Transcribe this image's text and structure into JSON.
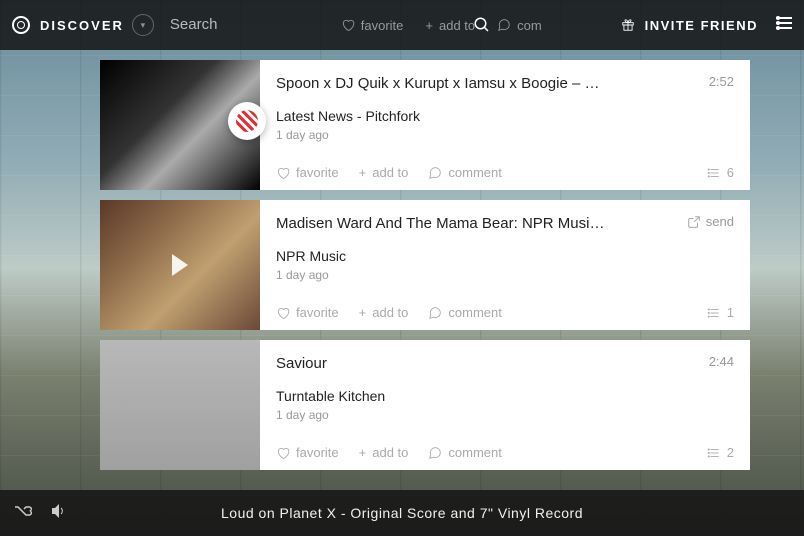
{
  "header": {
    "brand": "DISCOVER",
    "search_placeholder": "Search",
    "favorite": "favorite",
    "addto": "add to",
    "comment": "com",
    "invite": "INVITE FRIEND"
  },
  "feed": [
    {
      "title": "Spoon x DJ Quik x Kurupt x Iamsu x Boogie – Songs fr...",
      "duration": "2:52",
      "source": "Latest News - Pitchfork",
      "ago": "1 day ago",
      "count": "6",
      "thumb": "bw",
      "badge": true
    },
    {
      "title": "Madisen Ward And The Mama Bear: NPR Music Tiny ...",
      "send": "send",
      "source": "NPR Music",
      "ago": "1 day ago",
      "count": "1",
      "thumb": "tiny",
      "play": true
    },
    {
      "title": "Saviour",
      "duration": "2:44",
      "source": "Turntable Kitchen",
      "ago": "1 day ago",
      "count": "2",
      "thumb": "min"
    }
  ],
  "actions": {
    "favorite": "favorite",
    "addto": "add to",
    "comment": "comment"
  },
  "player": {
    "title": "Loud on Planet X - Original Score and 7\" Vinyl Record"
  }
}
